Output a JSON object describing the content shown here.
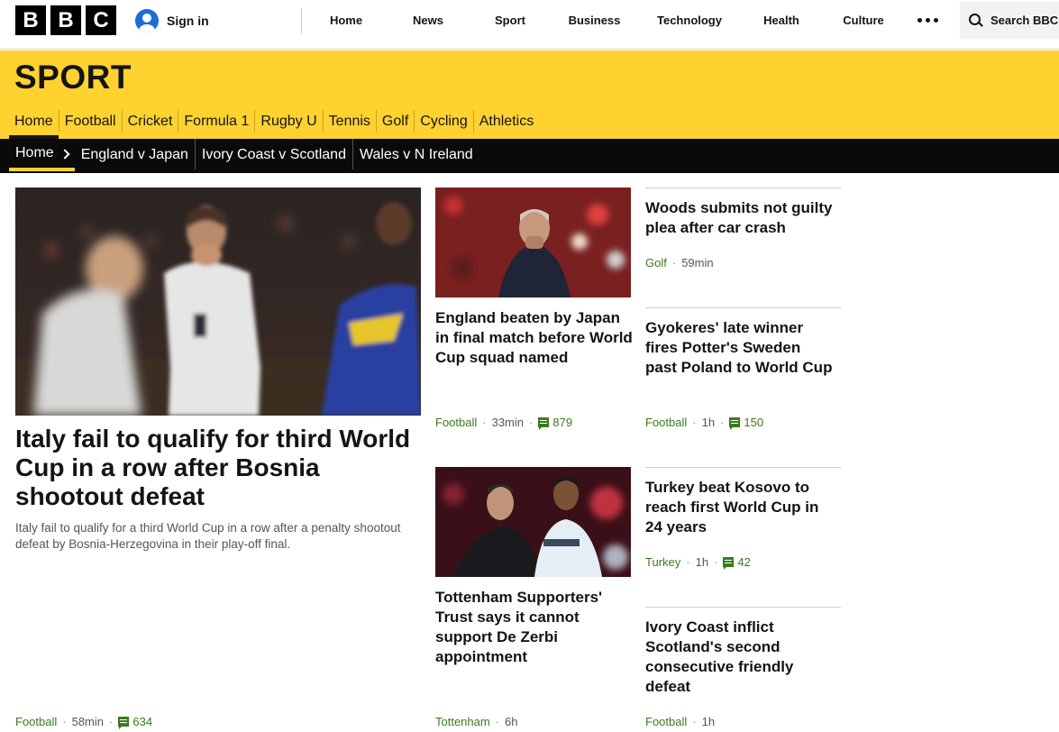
{
  "header": {
    "logo": [
      "B",
      "B",
      "C"
    ],
    "sign_in": "Sign in",
    "nav": [
      "Home",
      "News",
      "Sport",
      "Business",
      "Technology",
      "Health",
      "Culture"
    ],
    "search": "Search BBC"
  },
  "sport": {
    "title": "SPORT",
    "nav": [
      "Home",
      "Football",
      "Cricket",
      "Formula 1",
      "Rugby U",
      "Tennis",
      "Golf",
      "Cycling",
      "Athletics"
    ],
    "active": "Home"
  },
  "subnav": {
    "home": "Home",
    "items": [
      "England v Japan",
      "Ivory Coast v Scotland",
      "Wales v N Ireland"
    ]
  },
  "lead": {
    "headline": "Italy fail to qualify for third World Cup in a row after Bosnia shootout defeat",
    "summary": "Italy fail to qualify for a third World Cup in a row after a penalty shootout defeat by Bosnia-Herzegovina in their play-off final.",
    "topic": "Football",
    "time": "58min",
    "comments": "634"
  },
  "stories": [
    {
      "headline": "England beaten by Japan in final match before World Cup squad named",
      "topic": "Football",
      "time": "33min",
      "comments": "879"
    },
    {
      "headline": "Tottenham Supporters' Trust says it cannot support De Zerbi appointment",
      "topic": "Tottenham",
      "time": "6h",
      "comments": ""
    },
    {
      "headline": "Woods submits not guilty plea after car crash",
      "topic": "Golf",
      "time": "59min",
      "comments": ""
    },
    {
      "headline": "Gyokeres' late winner fires Potter's Sweden past Poland to World Cup",
      "topic": "Football",
      "time": "1h",
      "comments": "150"
    },
    {
      "headline": "Turkey beat Kosovo to reach first World Cup in 24 years",
      "topic": "Turkey",
      "time": "1h",
      "comments": "42"
    },
    {
      "headline": "Ivory Coast inflict Scotland's second consecutive friendly defeat",
      "topic": "Football",
      "time": "1h",
      "comments": ""
    }
  ],
  "colors": {
    "sport_yellow": "#ffd230",
    "topic_green": "#3a7a1e",
    "signin_blue": "#1b6ed5"
  }
}
